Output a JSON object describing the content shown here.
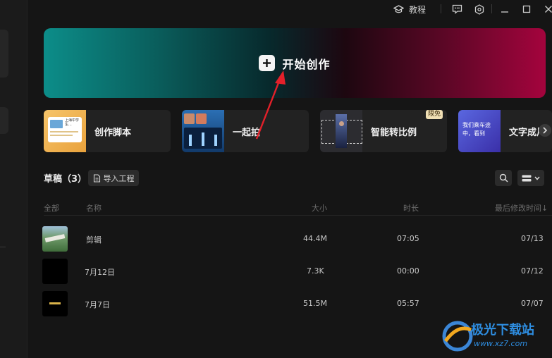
{
  "topbar": {
    "tutorial_label": "教程"
  },
  "hero": {
    "label": "开始创作"
  },
  "cards": [
    {
      "title": "创作脚本",
      "thumb_text": "上海中学生..."
    },
    {
      "title": "一起拍"
    },
    {
      "title": "智能转比例",
      "badge": "限免"
    },
    {
      "title": "文字成片",
      "thumb_text": "我们乘车途中，看到"
    }
  ],
  "drafts": {
    "title": "草稿（3）",
    "import_label": "导入工程",
    "columns": {
      "all": "全部",
      "name": "名称",
      "size": "大小",
      "duration": "时长",
      "modified": "最后修改时间↓"
    },
    "rows": [
      {
        "name": "剪辑",
        "size": "44.4M",
        "duration": "07:05",
        "modified": "07/13"
      },
      {
        "name": "7月12日",
        "size": "7.3K",
        "duration": "00:00",
        "modified": "07/12"
      },
      {
        "name": "7月7日",
        "size": "51.5M",
        "duration": "05:57",
        "modified": "07/07"
      }
    ]
  },
  "watermark": {
    "name": "极光下载站",
    "url": "www.xz7.com"
  }
}
